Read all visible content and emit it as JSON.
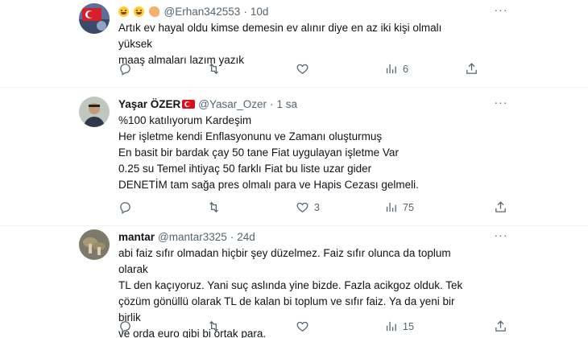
{
  "tweets": [
    {
      "name": "",
      "handle": "@Erhan342553",
      "time": "10d",
      "lines": [
        "Artık ev hayal oldu kimse demesin ev alınır diye en az iki kişi olmalı yüksek",
        "maaş almaları lazım yazık"
      ],
      "replies": "",
      "retweets": "",
      "likes": "",
      "views": "6",
      "emojis": [
        "grinning-face",
        "grinning-face",
        "ear"
      ]
    },
    {
      "name": "Yaşar ÖZER",
      "handle": "@Yasar_Ozer",
      "time": "1 sa",
      "lines": [
        "%100 katılıyorum Kardeşim",
        "Her işletme kendi Enflasyonunu ve Zamanı oluşturmuş",
        "En basit bir bardak çay 50 tane Fiat uygulayan işletme Var",
        "0.25 su Temel ihtiyaç 50 farklı Fiat bu liste uzar gider",
        "DENETİM tam sağa pres olmalı para ve Hapis Cezası gelmeli."
      ],
      "replies": "",
      "retweets": "",
      "likes": "3",
      "views": "75",
      "badge": "turkish-flag"
    },
    {
      "name": "mantar",
      "handle": "@mantar3325",
      "time": "24d",
      "lines": [
        "abi faiz sıfır olmadan hiçbir şey düzelmez. Faiz sıfır olunca da toplum olarak",
        "TL den kaçıyoruz. Yani suç aslında yine bizde. Fazla acikgoz olduk. Tek",
        "çözüm gönüllü olarak TL de kalan bi toplum ve sıfır faiz. Ya da yeni bir birlik",
        "ve orda euro gibi bi ortak para."
      ],
      "replies": "",
      "retweets": "",
      "likes": "",
      "views": "15"
    }
  ],
  "separator": "·",
  "more_glyph": "···",
  "colors": {
    "text": "#0f1419",
    "muted": "#536471",
    "divider": "#eff3f4"
  }
}
